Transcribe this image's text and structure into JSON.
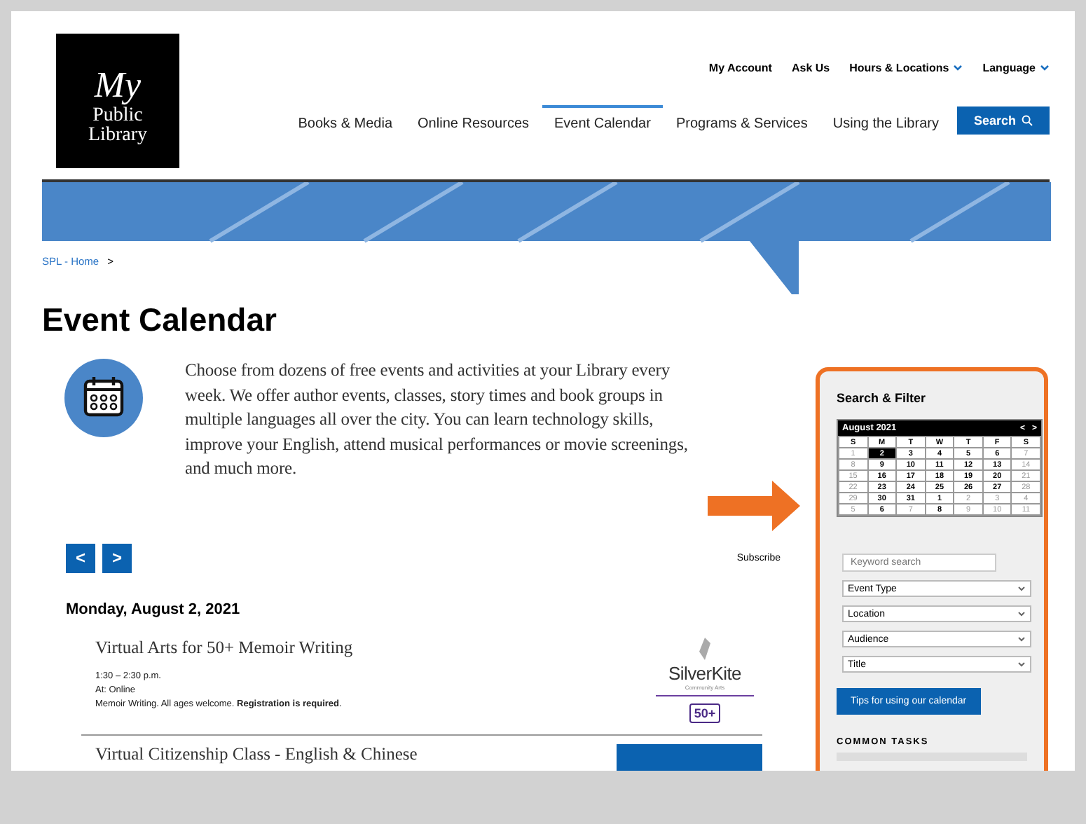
{
  "logo": {
    "line_1": "My",
    "line_2": "Public",
    "line_3": "Library"
  },
  "utility_links": [
    {
      "label": "My Account",
      "dropdown": false
    },
    {
      "label": "Ask Us",
      "dropdown": false
    },
    {
      "label": "Hours & Locations",
      "dropdown": true
    },
    {
      "label": "Language",
      "dropdown": true
    }
  ],
  "nav": [
    {
      "label": "Books & Media",
      "selected": false
    },
    {
      "label": "Online Resources",
      "selected": false
    },
    {
      "label": "Event Calendar",
      "selected": true
    },
    {
      "label": "Programs & Services",
      "selected": false
    },
    {
      "label": "Using the Library",
      "selected": false
    }
  ],
  "search_button": "Search",
  "breadcrumb": {
    "link": "SPL - Home",
    "separator": ">"
  },
  "title": "Event Calendar",
  "intro": "Choose from dozens of free events and activities at your Library every week. We offer author events, classes, story times and book groups in multiple languages all over the city. You can learn technology skills, improve your English, attend musical performances or movie screenings, and much more.",
  "pager": {
    "prev": "<",
    "next": ">"
  },
  "subscribe": "Subscribe",
  "date_heading": "Monday, August 2, 2021",
  "events": [
    {
      "title": "Virtual Arts for 50+ Memoir Writing",
      "time": "1:30 – 2:30 p.m.",
      "location": "At: Online",
      "description": "Memoir Writing. All ages welcome. **Registration is required**.",
      "sponsor": {
        "name": "SilverKite",
        "subtitle": "Community Arts",
        "badge": "50+"
      }
    },
    {
      "title": "Virtual Citizenship Class - English & Chinese"
    }
  ],
  "sidebar": {
    "heading": "Search & Filter",
    "calendar": {
      "month": "August 2021",
      "prev": "<",
      "next": ">",
      "weekdays": [
        "S",
        "M",
        "T",
        "W",
        "T",
        "F",
        "S"
      ],
      "weeks": [
        [
          {
            "d": "1",
            "muted": true,
            "selected": false
          },
          {
            "d": "2",
            "muted": false,
            "selected": true
          },
          {
            "d": "3",
            "muted": false,
            "selected": false
          },
          {
            "d": "4",
            "muted": false,
            "selected": false
          },
          {
            "d": "5",
            "muted": false,
            "selected": false
          },
          {
            "d": "6",
            "muted": false,
            "selected": false
          },
          {
            "d": "7",
            "muted": true,
            "selected": false
          }
        ],
        [
          {
            "d": "8",
            "muted": true,
            "selected": false
          },
          {
            "d": "9",
            "muted": false,
            "selected": false
          },
          {
            "d": "10",
            "muted": false,
            "selected": false
          },
          {
            "d": "11",
            "muted": false,
            "selected": false
          },
          {
            "d": "12",
            "muted": false,
            "selected": false
          },
          {
            "d": "13",
            "muted": false,
            "selected": false
          },
          {
            "d": "14",
            "muted": true,
            "selected": false
          }
        ],
        [
          {
            "d": "15",
            "muted": true,
            "selected": false
          },
          {
            "d": "16",
            "muted": false,
            "selected": false
          },
          {
            "d": "17",
            "muted": false,
            "selected": false
          },
          {
            "d": "18",
            "muted": false,
            "selected": false
          },
          {
            "d": "19",
            "muted": false,
            "selected": false
          },
          {
            "d": "20",
            "muted": false,
            "selected": false
          },
          {
            "d": "21",
            "muted": true,
            "selected": false
          }
        ],
        [
          {
            "d": "22",
            "muted": true,
            "selected": false
          },
          {
            "d": "23",
            "muted": false,
            "selected": false
          },
          {
            "d": "24",
            "muted": false,
            "selected": false
          },
          {
            "d": "25",
            "muted": false,
            "selected": false
          },
          {
            "d": "26",
            "muted": false,
            "selected": false
          },
          {
            "d": "27",
            "muted": false,
            "selected": false
          },
          {
            "d": "28",
            "muted": true,
            "selected": false
          }
        ],
        [
          {
            "d": "29",
            "muted": true,
            "selected": false
          },
          {
            "d": "30",
            "muted": false,
            "selected": false
          },
          {
            "d": "31",
            "muted": false,
            "selected": false
          },
          {
            "d": "1",
            "muted": false,
            "selected": false
          },
          {
            "d": "2",
            "muted": true,
            "selected": false
          },
          {
            "d": "3",
            "muted": true,
            "selected": false
          },
          {
            "d": "4",
            "muted": true,
            "selected": false
          }
        ],
        [
          {
            "d": "5",
            "muted": true,
            "selected": false
          },
          {
            "d": "6",
            "muted": false,
            "selected": false
          },
          {
            "d": "7",
            "muted": true,
            "selected": false
          },
          {
            "d": "8",
            "muted": false,
            "selected": false
          },
          {
            "d": "9",
            "muted": true,
            "selected": false
          },
          {
            "d": "10",
            "muted": true,
            "selected": false
          },
          {
            "d": "11",
            "muted": true,
            "selected": false
          }
        ]
      ]
    },
    "keyword": {
      "placeholder": "Keyword search"
    },
    "filters": [
      "Event Type",
      "Location",
      "Audience",
      "Title"
    ],
    "tips_button": "Tips for using our calendar",
    "common_tasks": "COMMON TASKS"
  }
}
